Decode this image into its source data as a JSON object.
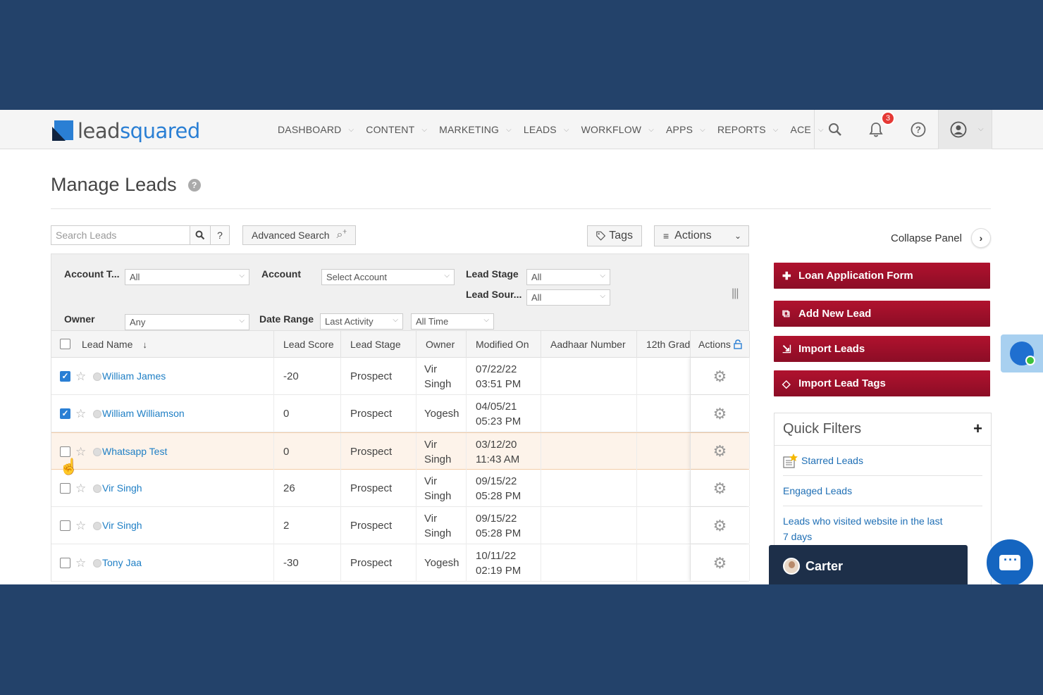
{
  "logo": {
    "part1": "lead",
    "part2": "squared"
  },
  "nav": {
    "items": [
      {
        "label": "DASHBOARD"
      },
      {
        "label": "CONTENT"
      },
      {
        "label": "MARKETING"
      },
      {
        "label": "LEADS"
      },
      {
        "label": "WORKFLOW"
      },
      {
        "label": "APPS"
      },
      {
        "label": "REPORTS"
      },
      {
        "label": "ACE"
      }
    ],
    "notification_count": "3"
  },
  "page": {
    "title": "Manage Leads",
    "help": "?"
  },
  "toolbar": {
    "search_placeholder": "Search Leads",
    "search_help": "?",
    "advanced_search": "Advanced Search",
    "tags": "Tags",
    "actions": "Actions",
    "collapse_panel": "Collapse Panel"
  },
  "filters": {
    "account_type_label": "Account T...",
    "account_type_value": "All",
    "account_label": "Account",
    "account_value": "Select Account",
    "lead_stage_label": "Lead Stage",
    "lead_stage_value": "All",
    "lead_source_label": "Lead Sour...",
    "lead_source_value": "All",
    "owner_label": "Owner",
    "owner_value": "Any",
    "date_range_label": "Date Range",
    "date_range_value": "Last Activity",
    "time_value": "All Time"
  },
  "table": {
    "headers": {
      "lead_name": "Lead Name",
      "lead_score": "Lead Score",
      "lead_stage": "Lead Stage",
      "owner": "Owner",
      "modified_on": "Modified On",
      "aadhaar": "Aadhaar Number",
      "grade": "12th Grad",
      "actions": "Actions"
    },
    "rows": [
      {
        "name": "William James",
        "score": "-20",
        "stage": "Prospect",
        "owner": "Vir Singh",
        "date": "07/22/22",
        "time": "03:51 PM",
        "checked": true
      },
      {
        "name": "William Williamson",
        "score": "0",
        "stage": "Prospect",
        "owner": "Yogesh",
        "date": "04/05/21",
        "time": "05:23 PM",
        "checked": true
      },
      {
        "name": "Whatsapp Test",
        "score": "0",
        "stage": "Prospect",
        "owner": "Vir Singh",
        "date": "03/12/20",
        "time": "11:43 AM",
        "checked": false
      },
      {
        "name": "Vir Singh",
        "score": "26",
        "stage": "Prospect",
        "owner": "Vir Singh",
        "date": "09/15/22",
        "time": "05:28 PM",
        "checked": false
      },
      {
        "name": "Vir Singh",
        "score": "2",
        "stage": "Prospect",
        "owner": "Vir Singh",
        "date": "09/15/22",
        "time": "05:28 PM",
        "checked": false
      },
      {
        "name": "Tony Jaa",
        "score": "-30",
        "stage": "Prospect",
        "owner": "Yogesh",
        "date": "10/11/22",
        "time": "02:19 PM",
        "checked": false
      }
    ]
  },
  "right_panel": {
    "buttons": [
      "Loan Application Form",
      "Add New Lead",
      "Import Leads",
      "Import Lead Tags"
    ],
    "quick_filters_title": "Quick Filters",
    "quick_filters": [
      "Starred Leads",
      "Engaged Leads",
      "Leads who visited website in the last 7 days"
    ]
  },
  "chat": {
    "agent_name": "Carter"
  },
  "colors": {
    "brand_red": "#9e1029",
    "link_blue": "#1f7fc5",
    "background": "#23426a"
  }
}
